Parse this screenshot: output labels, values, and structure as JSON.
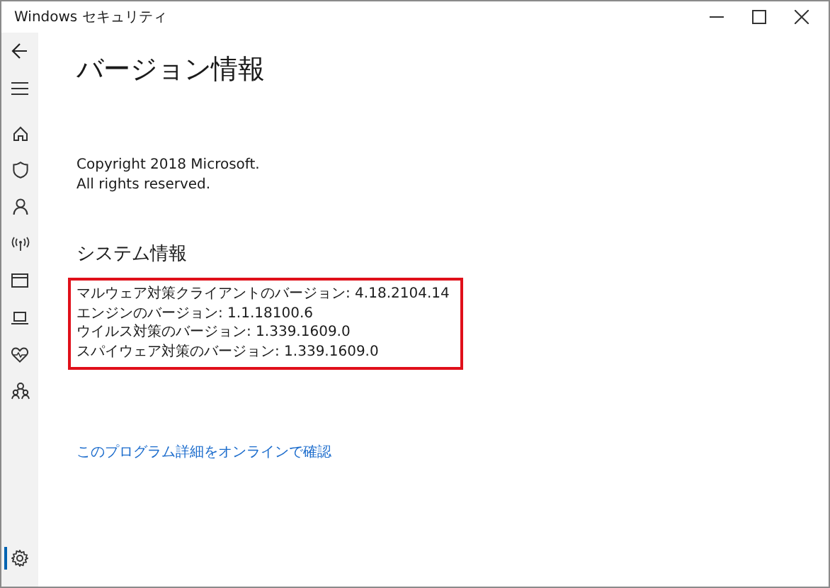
{
  "window": {
    "title": "Windows セキュリティ"
  },
  "nav": [
    {
      "kind": "back",
      "selected": false
    },
    {
      "kind": "menu",
      "selected": false
    },
    {
      "kind": "home",
      "selected": false
    },
    {
      "kind": "shield",
      "selected": false
    },
    {
      "kind": "person",
      "selected": false
    },
    {
      "kind": "antenna",
      "selected": false
    },
    {
      "kind": "browser",
      "selected": false
    },
    {
      "kind": "laptop",
      "selected": false
    },
    {
      "kind": "heart",
      "selected": false
    },
    {
      "kind": "family",
      "selected": false
    },
    {
      "kind": "settings",
      "selected": true
    }
  ],
  "page": {
    "title": "バージョン情報",
    "copyright": [
      "Copyright 2018 Microsoft.",
      "All rights reserved."
    ],
    "system_heading": "システム情報",
    "versions": [
      "マルウェア対策クライアントのバージョン: 4.18.2104.14",
      "エンジンのバージョン: 1.1.18100.6",
      "ウイルス対策のバージョン: 1.339.1609.0",
      "スパイウェア対策のバージョン: 1.339.1609.0"
    ],
    "link": "このプログラム詳細をオンラインで確認"
  }
}
